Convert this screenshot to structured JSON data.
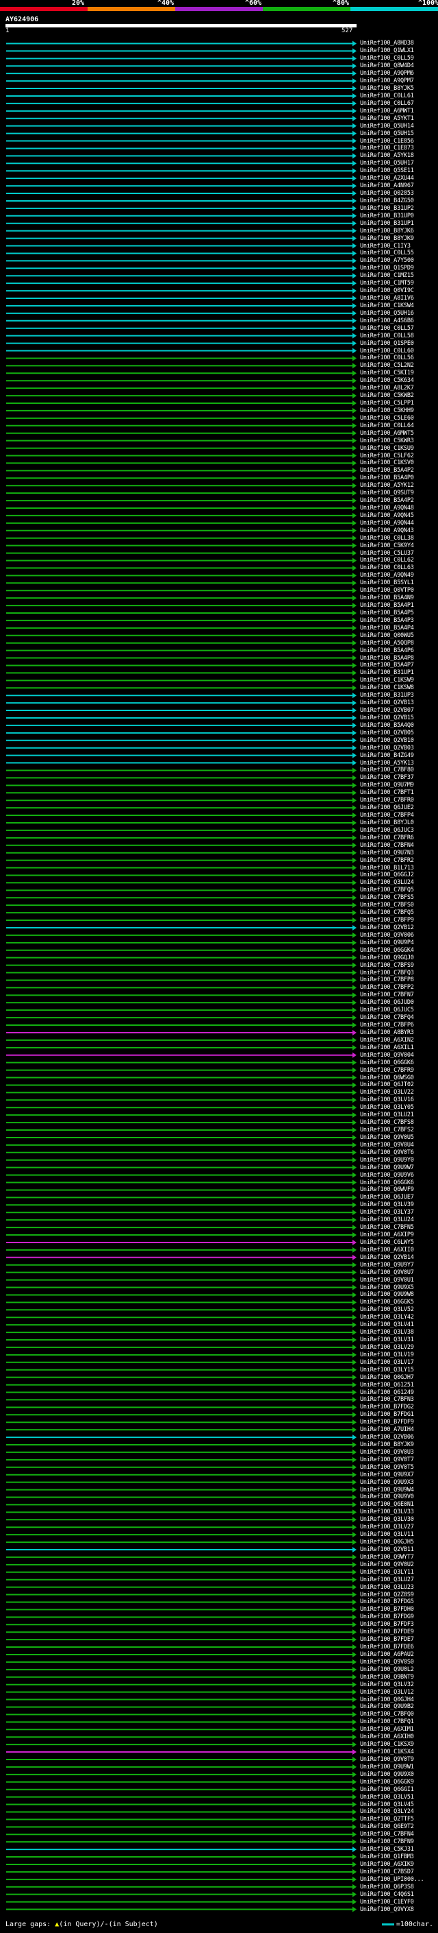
{
  "scale": {
    "labels": [
      "20%",
      "^40%",
      "^60%",
      "^80%",
      "^100%"
    ],
    "colors": [
      "#e0001b",
      "#f07c00",
      "#a020c8",
      "#12b010",
      "#00cccc"
    ]
  },
  "query": {
    "id": "AY624906",
    "start": "1",
    "end": "527"
  },
  "footer": {
    "gaps_label": "Large gaps:",
    "gap_query_glyph": "▲",
    "gap_query_text": "(in Query)/",
    "gap_subject_text": "(in Subject)",
    "scale_text": "=100char."
  },
  "colors": {
    "cyan": "#00cccc",
    "green": "#12b010",
    "magenta": "#cc22cc",
    "white": "#ffffff",
    "yellow": "#ffff00",
    "black": "#000000"
  },
  "hits": [
    {
      "label": "UniRef100_A8HD38",
      "color": "cyan"
    },
    {
      "label": "UniRef100_Q1WLX1",
      "color": "cyan"
    },
    {
      "label": "UniRef100_C0LL59",
      "color": "cyan"
    },
    {
      "label": "UniRef100_Q8W4D4",
      "color": "cyan"
    },
    {
      "label": "UniRef100_A9QPM6",
      "color": "cyan"
    },
    {
      "label": "UniRef100_A9QPM7",
      "color": "cyan"
    },
    {
      "label": "UniRef100_B8YJK5",
      "color": "cyan"
    },
    {
      "label": "UniRef100_C0LL61",
      "color": "cyan"
    },
    {
      "label": "UniRef100_C0LL67",
      "color": "cyan"
    },
    {
      "label": "UniRef100_A6MWT1",
      "color": "cyan"
    },
    {
      "label": "UniRef100_A5YKT1",
      "color": "cyan"
    },
    {
      "label": "UniRef100_Q5UH14",
      "color": "cyan"
    },
    {
      "label": "UniRef100_Q5UH15",
      "color": "cyan"
    },
    {
      "label": "UniRef100_C1E856",
      "color": "cyan"
    },
    {
      "label": "UniRef100_C1E873",
      "color": "cyan"
    },
    {
      "label": "UniRef100_A5YK18",
      "color": "cyan"
    },
    {
      "label": "UniRef100_Q5UH17",
      "color": "cyan"
    },
    {
      "label": "UniRef100_Q5SE11",
      "color": "cyan"
    },
    {
      "label": "UniRef100_A2XU44",
      "color": "cyan"
    },
    {
      "label": "UniRef100_A4N967",
      "color": "cyan"
    },
    {
      "label": "UniRef100_Q02853",
      "color": "cyan"
    },
    {
      "label": "UniRef100_B4ZG50",
      "color": "cyan"
    },
    {
      "label": "UniRef100_B31UP2",
      "color": "cyan"
    },
    {
      "label": "UniRef100_B31UP0",
      "color": "cyan"
    },
    {
      "label": "UniRef100_B31UP1",
      "color": "cyan"
    },
    {
      "label": "UniRef100_B8YJK6",
      "color": "cyan"
    },
    {
      "label": "UniRef100_B8YJK9",
      "color": "cyan"
    },
    {
      "label": "UniRef100_C1IY3",
      "color": "cyan"
    },
    {
      "label": "UniRef100_C0LL55",
      "color": "cyan"
    },
    {
      "label": "UniRef100_A7Y500",
      "color": "cyan"
    },
    {
      "label": "UniRef100_Q1SPD9",
      "color": "cyan"
    },
    {
      "label": "UniRef100_C1MZ15",
      "color": "cyan"
    },
    {
      "label": "UniRef100_C1MT59",
      "color": "cyan"
    },
    {
      "label": "UniRef100_Q0VI9C",
      "color": "cyan"
    },
    {
      "label": "UniRef100_A8I1V6",
      "color": "cyan"
    },
    {
      "label": "UniRef100_C1KSW4",
      "color": "cyan"
    },
    {
      "label": "UniRef100_Q5UH16",
      "color": "cyan"
    },
    {
      "label": "UniRef100_A4S6B6",
      "color": "cyan"
    },
    {
      "label": "UniRef100_C0LL57",
      "color": "cyan"
    },
    {
      "label": "UniRef100_C0LL58",
      "color": "cyan"
    },
    {
      "label": "UniRef100_Q1SPE0",
      "color": "cyan"
    },
    {
      "label": "UniRef100_C0LL60",
      "color": "cyan"
    },
    {
      "label": "UniRef100_C0LL56",
      "color": "green"
    },
    {
      "label": "UniRef100_C5L2N2",
      "color": "green"
    },
    {
      "label": "UniRef100_C5KI19",
      "color": "green"
    },
    {
      "label": "UniRef100_C5K634",
      "color": "green"
    },
    {
      "label": "UniRef100_A8L2K7",
      "color": "green"
    },
    {
      "label": "UniRef100_C5KWB2",
      "color": "green"
    },
    {
      "label": "UniRef100_C5LPP1",
      "color": "green"
    },
    {
      "label": "UniRef100_C5KHH9",
      "color": "green"
    },
    {
      "label": "UniRef100_C5LE60",
      "color": "green"
    },
    {
      "label": "UniRef100_C0LL64",
      "color": "green"
    },
    {
      "label": "UniRef100_A6MWT5",
      "color": "green"
    },
    {
      "label": "UniRef100_C5KWR3",
      "color": "green"
    },
    {
      "label": "UniRef100_C1KSU9",
      "color": "green"
    },
    {
      "label": "UniRef100_C5LF62",
      "color": "green"
    },
    {
      "label": "UniRef100_C1KSV0",
      "color": "green"
    },
    {
      "label": "UniRef100_B5A4P2",
      "color": "green"
    },
    {
      "label": "UniRef100_B5A4P0",
      "color": "green"
    },
    {
      "label": "UniRef100_A5YK12",
      "color": "green"
    },
    {
      "label": "UniRef100_Q9SUT9",
      "color": "green"
    },
    {
      "label": "UniRef100_B5A4P2",
      "color": "green"
    },
    {
      "label": "UniRef100_A9QN48",
      "color": "green"
    },
    {
      "label": "UniRef100_A9QN45",
      "color": "green"
    },
    {
      "label": "UniRef100_A9QN44",
      "color": "green"
    },
    {
      "label": "UniRef100_A9QN43",
      "color": "green"
    },
    {
      "label": "UniRef100_C0LL38",
      "color": "green"
    },
    {
      "label": "UniRef100_C5K9Y4",
      "color": "green"
    },
    {
      "label": "UniRef100_C5LU37",
      "color": "green"
    },
    {
      "label": "UniRef100_C0LL62",
      "color": "green"
    },
    {
      "label": "UniRef100_C0LL63",
      "color": "green"
    },
    {
      "label": "UniRef100_A9QN49",
      "color": "green"
    },
    {
      "label": "UniRef100_B5SYL1",
      "color": "green"
    },
    {
      "label": "UniRef100_Q0VTP0",
      "color": "green"
    },
    {
      "label": "UniRef100_B5A4N9",
      "color": "green"
    },
    {
      "label": "UniRef100_B5A4P1",
      "color": "green"
    },
    {
      "label": "UniRef100_B5A4P5",
      "color": "green"
    },
    {
      "label": "UniRef100_B5A4P3",
      "color": "green"
    },
    {
      "label": "UniRef100_B5A4P4",
      "color": "green"
    },
    {
      "label": "UniRef100_Q00WU5",
      "color": "green"
    },
    {
      "label": "UniRef100_A5QQP8",
      "color": "green"
    },
    {
      "label": "UniRef100_B5A4P6",
      "color": "green"
    },
    {
      "label": "UniRef100_B5A4P8",
      "color": "green"
    },
    {
      "label": "UniRef100_B5A4P7",
      "color": "green"
    },
    {
      "label": "UniRef100_B31UP1",
      "color": "green"
    },
    {
      "label": "UniRef100_C1KSW9",
      "color": "green"
    },
    {
      "label": "UniRef100_C1KSW8",
      "color": "green"
    },
    {
      "label": "UniRef100_B31UP3",
      "color": "cyan"
    },
    {
      "label": "UniRef100_Q2VB13",
      "color": "cyan"
    },
    {
      "label": "UniRef100_Q2VB07",
      "color": "cyan"
    },
    {
      "label": "UniRef100_Q2VB15",
      "color": "cyan"
    },
    {
      "label": "UniRef100_B5A4Q0",
      "color": "cyan"
    },
    {
      "label": "UniRef100_Q2VB05",
      "color": "cyan"
    },
    {
      "label": "UniRef100_Q2VB10",
      "color": "cyan"
    },
    {
      "label": "UniRef100_Q2VB03",
      "color": "cyan"
    },
    {
      "label": "UniRef100_B4ZG49",
      "color": "cyan"
    },
    {
      "label": "UniRef100_A5YK13",
      "color": "cyan"
    },
    {
      "label": "UniRef100_C7BF80",
      "color": "green"
    },
    {
      "label": "UniRef100_C7BF37",
      "color": "green"
    },
    {
      "label": "UniRef100_Q9U7M9",
      "color": "green"
    },
    {
      "label": "UniRef100_C7BFT1",
      "color": "green"
    },
    {
      "label": "UniRef100_C7BFR0",
      "color": "green"
    },
    {
      "label": "UniRef100_Q6JUE2",
      "color": "green"
    },
    {
      "label": "UniRef100_C7BFP4",
      "color": "green"
    },
    {
      "label": "UniRef100_B8YJL0",
      "color": "green"
    },
    {
      "label": "UniRef100_Q6JUC3",
      "color": "green"
    },
    {
      "label": "UniRef100_C7BFR6",
      "color": "green"
    },
    {
      "label": "UniRef100_C7BFN4",
      "color": "green"
    },
    {
      "label": "UniRef100_Q9U7N3",
      "color": "green"
    },
    {
      "label": "UniRef100_C7BFR2",
      "color": "green"
    },
    {
      "label": "UniRef100_B1L713",
      "color": "green"
    },
    {
      "label": "UniRef100_Q6GGJ2",
      "color": "green"
    },
    {
      "label": "UniRef100_Q3LU24",
      "color": "green"
    },
    {
      "label": "UniRef100_C7BFQ5",
      "color": "green"
    },
    {
      "label": "UniRef100_C7BFS5",
      "color": "green"
    },
    {
      "label": "UniRef100_C7BFS0",
      "color": "green"
    },
    {
      "label": "UniRef100_C7BFQ5",
      "color": "green"
    },
    {
      "label": "UniRef100_C7BFP9",
      "color": "green"
    },
    {
      "label": "UniRef100_Q2VB12",
      "color": "cyan"
    },
    {
      "label": "UniRef100_Q9V006",
      "color": "green"
    },
    {
      "label": "UniRef100_Q9U9P4",
      "color": "green"
    },
    {
      "label": "UniRef100_Q6GGK4",
      "color": "green"
    },
    {
      "label": "UniRef100_Q9GQJ0",
      "color": "green"
    },
    {
      "label": "UniRef100_C7BFS9",
      "color": "green"
    },
    {
      "label": "UniRef100_C7BFQ3",
      "color": "green"
    },
    {
      "label": "UniRef100_C7BFP8",
      "color": "green"
    },
    {
      "label": "UniRef100_C7BFP2",
      "color": "green"
    },
    {
      "label": "UniRef100_C7BFN7",
      "color": "green"
    },
    {
      "label": "UniRef100_Q6JUD0",
      "color": "green"
    },
    {
      "label": "UniRef100_Q6JUC5",
      "color": "green"
    },
    {
      "label": "UniRef100_C7BFQ4",
      "color": "green"
    },
    {
      "label": "UniRef100_C7BFP6",
      "color": "green"
    },
    {
      "label": "UniRef100_A8BYR3",
      "color": "magenta"
    },
    {
      "label": "UniRef100_A6XIN2",
      "color": "green"
    },
    {
      "label": "UniRef100_A6XIL1",
      "color": "green"
    },
    {
      "label": "UniRef100_Q9V004",
      "color": "magenta"
    },
    {
      "label": "UniRef100_Q6GGK6",
      "color": "green"
    },
    {
      "label": "UniRef100_C7BFR9",
      "color": "green"
    },
    {
      "label": "UniRef100_Q6WSG0",
      "color": "green"
    },
    {
      "label": "UniRef100_Q6JT02",
      "color": "green"
    },
    {
      "label": "UniRef100_Q3LV22",
      "color": "green"
    },
    {
      "label": "UniRef100_Q3LV16",
      "color": "green"
    },
    {
      "label": "UniRef100_Q3LY05",
      "color": "green"
    },
    {
      "label": "UniRef100_Q3LU21",
      "color": "green"
    },
    {
      "label": "UniRef100_C7BFS8",
      "color": "green"
    },
    {
      "label": "UniRef100_C7BFS2",
      "color": "green"
    },
    {
      "label": "UniRef100_Q9V0U5",
      "color": "green"
    },
    {
      "label": "UniRef100_Q9V0U4",
      "color": "green"
    },
    {
      "label": "UniRef100_Q9V0T6",
      "color": "green"
    },
    {
      "label": "UniRef100_Q9U9Y0",
      "color": "green"
    },
    {
      "label": "UniRef100_Q9U9W7",
      "color": "green"
    },
    {
      "label": "UniRef100_Q9U9V6",
      "color": "green"
    },
    {
      "label": "UniRef100_Q6GGK6",
      "color": "green"
    },
    {
      "label": "UniRef100_Q6WVF9",
      "color": "green"
    },
    {
      "label": "UniRef100_Q6JUE7",
      "color": "green"
    },
    {
      "label": "UniRef100_Q3LV39",
      "color": "green"
    },
    {
      "label": "UniRef100_Q3LY37",
      "color": "green"
    },
    {
      "label": "UniRef100_Q3LU24",
      "color": "green"
    },
    {
      "label": "UniRef100_C7BFN5",
      "color": "green"
    },
    {
      "label": "UniRef100_A6XIP9",
      "color": "green"
    },
    {
      "label": "UniRef100_C6LWY5",
      "color": "magenta"
    },
    {
      "label": "UniRef100_A6XII0",
      "color": "green"
    },
    {
      "label": "UniRef100_Q2VB14",
      "color": "magenta"
    },
    {
      "label": "UniRef100_Q9U9Y7",
      "color": "green"
    },
    {
      "label": "UniRef100_Q9V0U7",
      "color": "green"
    },
    {
      "label": "UniRef100_Q9V0U1",
      "color": "green"
    },
    {
      "label": "UniRef100_Q9U9X5",
      "color": "green"
    },
    {
      "label": "UniRef100_Q9U9W8",
      "color": "green"
    },
    {
      "label": "UniRef100_Q6GGK5",
      "color": "green"
    },
    {
      "label": "UniRef100_Q3LV52",
      "color": "green"
    },
    {
      "label": "UniRef100_Q3LY42",
      "color": "green"
    },
    {
      "label": "UniRef100_Q3LV41",
      "color": "green"
    },
    {
      "label": "UniRef100_Q3LV38",
      "color": "green"
    },
    {
      "label": "UniRef100_Q3LV31",
      "color": "green"
    },
    {
      "label": "UniRef100_Q3LV29",
      "color": "green"
    },
    {
      "label": "UniRef100_Q3LV19",
      "color": "green"
    },
    {
      "label": "UniRef100_Q3LV17",
      "color": "green"
    },
    {
      "label": "UniRef100_Q3LY15",
      "color": "green"
    },
    {
      "label": "UniRef100_Q0GJH7",
      "color": "green"
    },
    {
      "label": "UniRef100_Q61251",
      "color": "green"
    },
    {
      "label": "UniRef100_Q61249",
      "color": "green"
    },
    {
      "label": "UniRef100_C7BFN3",
      "color": "green"
    },
    {
      "label": "UniRef100_B7FDG2",
      "color": "green"
    },
    {
      "label": "UniRef100_B7FDG1",
      "color": "green"
    },
    {
      "label": "UniRef100_B7FDF9",
      "color": "green"
    },
    {
      "label": "UniRef100_A7UIH4",
      "color": "green"
    },
    {
      "label": "UniRef100_Q2VB06",
      "color": "cyan"
    },
    {
      "label": "UniRef100_B8YJK9",
      "color": "green"
    },
    {
      "label": "UniRef100_Q9V0U3",
      "color": "green"
    },
    {
      "label": "UniRef100_Q9V0T7",
      "color": "green"
    },
    {
      "label": "UniRef100_Q9V0T5",
      "color": "green"
    },
    {
      "label": "UniRef100_Q9U9X7",
      "color": "green"
    },
    {
      "label": "UniRef100_Q9U9X3",
      "color": "green"
    },
    {
      "label": "UniRef100_Q9U9W4",
      "color": "green"
    },
    {
      "label": "UniRef100_Q9U9V0",
      "color": "green"
    },
    {
      "label": "UniRef100_Q6E0N1",
      "color": "green"
    },
    {
      "label": "UniRef100_Q3LV33",
      "color": "green"
    },
    {
      "label": "UniRef100_Q3LV30",
      "color": "green"
    },
    {
      "label": "UniRef100_Q3LV27",
      "color": "green"
    },
    {
      "label": "UniRef100_Q3LV11",
      "color": "green"
    },
    {
      "label": "UniRef100_Q0GJH5",
      "color": "green"
    },
    {
      "label": "UniRef100_Q2VB11",
      "color": "cyan"
    },
    {
      "label": "UniRef100_Q9WYT7",
      "color": "green"
    },
    {
      "label": "UniRef100_Q9V0U2",
      "color": "green"
    },
    {
      "label": "UniRef100_Q3LY11",
      "color": "green"
    },
    {
      "label": "UniRef100_Q3LU27",
      "color": "green"
    },
    {
      "label": "UniRef100_Q3LU23",
      "color": "green"
    },
    {
      "label": "UniRef100_Q2Z8S9",
      "color": "green"
    },
    {
      "label": "UniRef100_B7FDG5",
      "color": "green"
    },
    {
      "label": "UniRef100_B7FDH0",
      "color": "green"
    },
    {
      "label": "UniRef100_B7FDG9",
      "color": "green"
    },
    {
      "label": "UniRef100_B7FDF3",
      "color": "green"
    },
    {
      "label": "UniRef100_B7FDE9",
      "color": "green"
    },
    {
      "label": "UniRef100_B7FDE7",
      "color": "green"
    },
    {
      "label": "UniRef100_B7FDE6",
      "color": "green"
    },
    {
      "label": "UniRef100_A6PAU2",
      "color": "green"
    },
    {
      "label": "UniRef100_Q9V0S0",
      "color": "green"
    },
    {
      "label": "UniRef100_Q9U0L2",
      "color": "green"
    },
    {
      "label": "UniRef100_Q9BNT9",
      "color": "green"
    },
    {
      "label": "UniRef100_Q3LV32",
      "color": "green"
    },
    {
      "label": "UniRef100_Q3LV12",
      "color": "green"
    },
    {
      "label": "UniRef100_Q0GJH4",
      "color": "green"
    },
    {
      "label": "UniRef100_Q9U9B2",
      "color": "green"
    },
    {
      "label": "UniRef100_C7BFQ0",
      "color": "green"
    },
    {
      "label": "UniRef100_C7BFQ1",
      "color": "green"
    },
    {
      "label": "UniRef100_A6XIM1",
      "color": "green"
    },
    {
      "label": "UniRef100_A6XIH0",
      "color": "green"
    },
    {
      "label": "UniRef100_C1KSX9",
      "color": "green"
    },
    {
      "label": "UniRef100_C1KSX4",
      "color": "magenta"
    },
    {
      "label": "UniRef100_Q9V0T9",
      "color": "green"
    },
    {
      "label": "UniRef100_Q9U9W1",
      "color": "green"
    },
    {
      "label": "UniRef100_Q9U9X0",
      "color": "green"
    },
    {
      "label": "UniRef100_Q6GGK9",
      "color": "green"
    },
    {
      "label": "UniRef100_Q6GGI1",
      "color": "green"
    },
    {
      "label": "UniRef100_Q3LV51",
      "color": "green"
    },
    {
      "label": "UniRef100_Q3LV45",
      "color": "green"
    },
    {
      "label": "UniRef100_Q3LY24",
      "color": "green"
    },
    {
      "label": "UniRef100_Q2TTF5",
      "color": "green"
    },
    {
      "label": "UniRef100_Q6E9T2",
      "color": "green"
    },
    {
      "label": "UniRef100_C7BFN4",
      "color": "green"
    },
    {
      "label": "UniRef100_C7BFN9",
      "color": "green"
    },
    {
      "label": "UniRef100_C5KJ31",
      "color": "cyan"
    },
    {
      "label": "UniRef100_Q1FBM3",
      "color": "green"
    },
    {
      "label": "UniRef100_A6XIK9",
      "color": "green"
    },
    {
      "label": "UniRef100_C7BSD7",
      "color": "green"
    },
    {
      "label": "UniRef100_UPI000...",
      "color": "green"
    },
    {
      "label": "UniRef100_Q6P3S8",
      "color": "green"
    },
    {
      "label": "UniRef100_C4Q6S1",
      "color": "green"
    },
    {
      "label": "UniRef100_C1EYF0",
      "color": "green"
    },
    {
      "label": "UniRef100_Q9VYX8",
      "color": "green"
    }
  ]
}
